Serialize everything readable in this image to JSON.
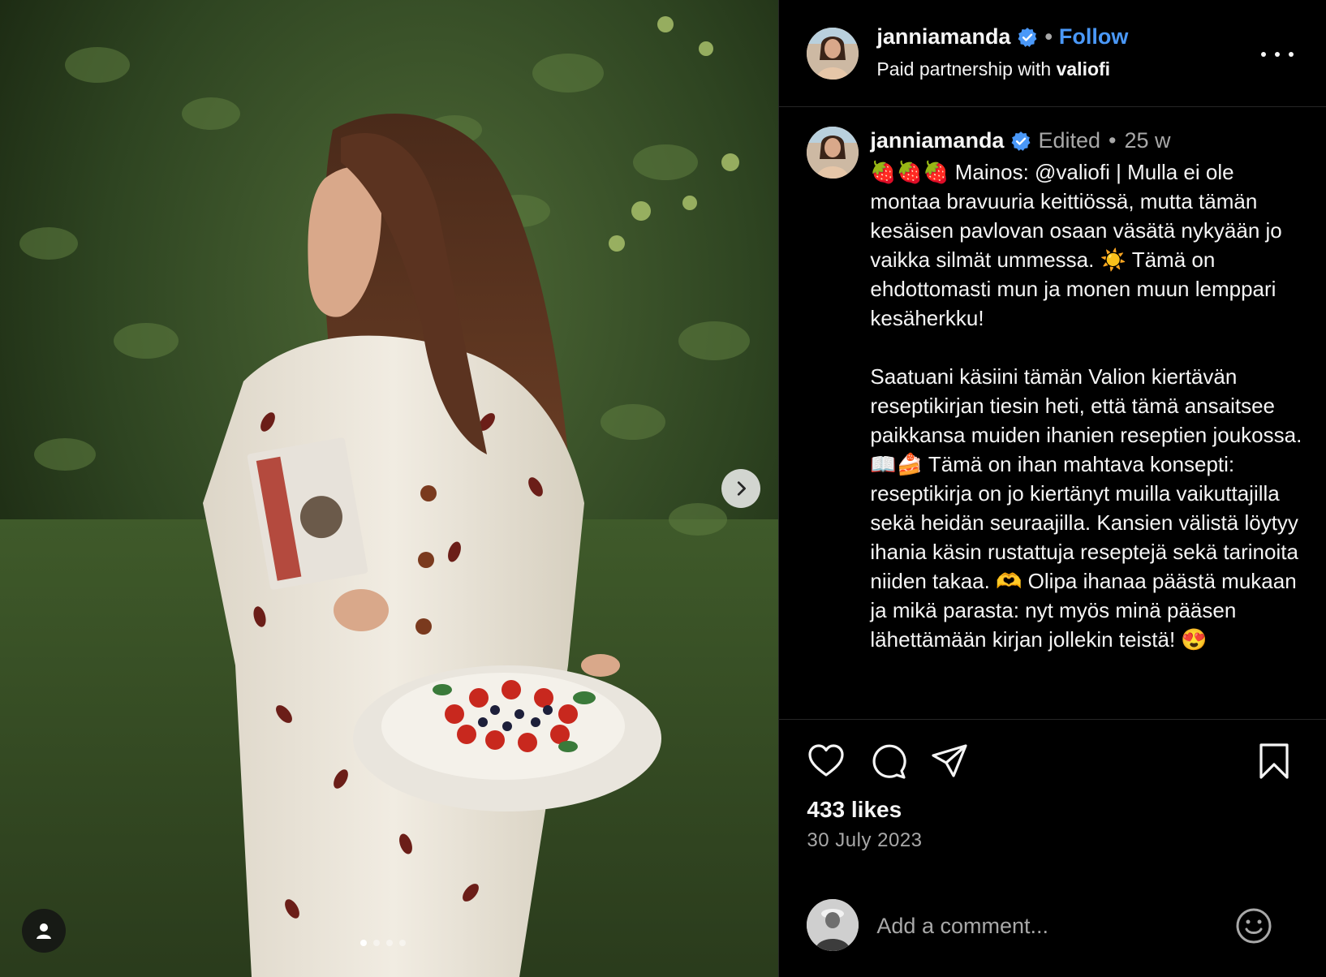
{
  "header": {
    "username": "janniamanda",
    "separator": "•",
    "follow_label": "Follow",
    "partnership_prefix": "Paid partnership with",
    "partnership_brand": "valiofi"
  },
  "caption": {
    "username": "janniamanda",
    "edited": "Edited",
    "separator": "•",
    "time_ago": "25 w",
    "paragraph_1": "🍓🍓🍓 Mainos: @valiofi | Mulla ei ole montaa bravuuria keittiössä, mutta tämän kesäisen pavlovan osaan väsätä nykyään jo vaikka silmät ummessa. ☀️ Tämä on ehdottomasti mun ja monen muun lemppari kesäherkku!",
    "paragraph_2": "Saatuani käsiini tämän Valion kiertävän reseptikirjan tiesin heti, että tämä ansaitsee paikkansa muiden ihanien reseptien joukossa. 📖🍰 Tämä on ihan mahtava konsepti: reseptikirja on jo kiertänyt muilla vaikuttajilla sekä heidän seuraajilla. Kansien välistä löytyy ihania käsin rustattuja reseptejä sekä tarinoita niiden takaa. 🫶 Olipa ihanaa päästä mukaan ja mikä parasta: nyt myös minä pääsen lähettämään kirjan jollekin teistä! 😍"
  },
  "engagement": {
    "likes": "433 likes",
    "date": "30 July 2023"
  },
  "comment": {
    "placeholder": "Add a comment..."
  },
  "carousel": {
    "slide_count": 4,
    "active_index": 0
  },
  "icons": {
    "like": "heart-icon",
    "comment": "comment-bubble-icon",
    "share": "paper-plane-icon",
    "save": "bookmark-icon",
    "emoji": "smiley-icon",
    "tag": "user-tag-icon",
    "next": "chevron-right-icon",
    "more": "more-options-icon",
    "verified": "verified-badge-icon"
  },
  "colors": {
    "accent": "#4a98f8",
    "background": "#000000",
    "text": "#f5f5f5",
    "muted": "#a8a8a8",
    "divider": "#262626"
  }
}
